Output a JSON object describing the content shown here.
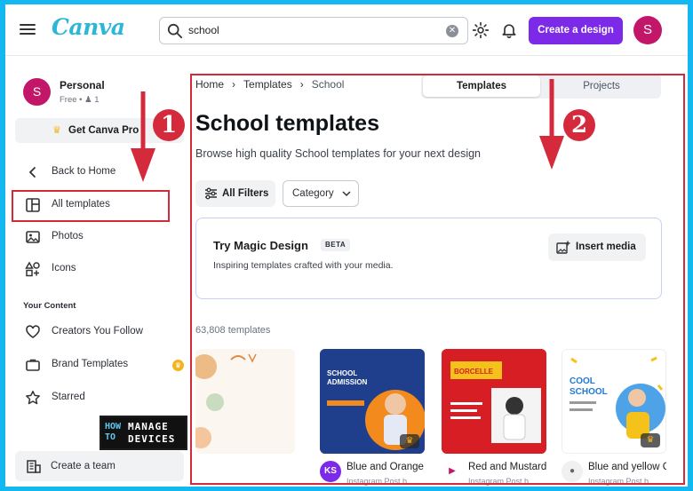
{
  "topbar": {
    "logo": "Canva",
    "search_value": "school",
    "create_label": "Create a design",
    "avatar_initial": "S"
  },
  "sidebar": {
    "account_initial": "S",
    "account_name": "Personal",
    "account_sub": "Free • ♟ 1",
    "pro_label": "Get Canva Pro",
    "back_label": "Back to Home",
    "items": [
      {
        "label": "All templates"
      },
      {
        "label": "Photos"
      },
      {
        "label": "Icons"
      }
    ],
    "section_label": "Your Content",
    "content_items": [
      {
        "label": "Creators You Follow"
      },
      {
        "label": "Brand Templates"
      },
      {
        "label": "Starred"
      }
    ],
    "team_label": "Create a team"
  },
  "watermark": {
    "how_to": "HOW\nTO",
    "line1": "MANAGE",
    "line2": "DEVICES"
  },
  "annotations": {
    "one": "1",
    "two": "2"
  },
  "main": {
    "breadcrumb": [
      "Home",
      "Templates",
      "School"
    ],
    "tabs": {
      "templates": "Templates",
      "projects": "Projects"
    },
    "title": "School templates",
    "subtitle": "Browse high quality School templates for your next design",
    "filters_label": "All Filters",
    "category_label": "Category",
    "magic": {
      "title": "Try Magic Design",
      "badge": "BETA",
      "subtitle": "Inspiring templates crafted with your media.",
      "insert_label": "Insert media"
    },
    "count": "63,808 templates",
    "cards": [
      {
        "title": "",
        "sub": "",
        "av": ""
      },
      {
        "title": "Blue and Orange School Admission",
        "sub": "Instagram Post b...",
        "av": "KS",
        "thumb_text": "SCHOOL ADMISSION"
      },
      {
        "title": "Red and Mustard Borcelle School",
        "sub": "Instagram Post b...",
        "av": "",
        "thumb_text": "BORCELLE SCHOOL"
      },
      {
        "title": "Blue and yellow Cool School",
        "sub": "Instagram Post b...",
        "av": "",
        "thumb_text": "COOL SCHOOL"
      }
    ]
  }
}
